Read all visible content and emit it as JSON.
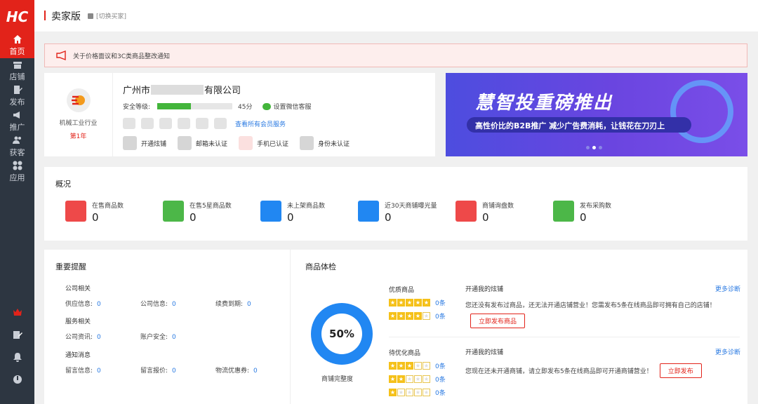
{
  "logo": {
    "text": "HC"
  },
  "sidebar": {
    "items": [
      {
        "label": "首页",
        "icon": "home-icon"
      },
      {
        "label": "店铺",
        "icon": "shop-icon"
      },
      {
        "label": "发布",
        "icon": "publish-icon"
      },
      {
        "label": "推广",
        "icon": "megaphone-icon"
      },
      {
        "label": "获客",
        "icon": "users-icon"
      },
      {
        "label": "应用",
        "icon": "apps-icon"
      }
    ],
    "bottom_icons": [
      "crown-icon",
      "edit-icon",
      "bell-icon",
      "power-icon"
    ]
  },
  "header": {
    "title": "卖家版",
    "switch_label": "[切换买家]"
  },
  "notice": {
    "text": "关于价格面议和3C类商品整改通知"
  },
  "company": {
    "industry": "机械工业行业",
    "years": "第1年",
    "name_prefix": "广州市",
    "name_suffix": "有限公司",
    "security_label": "安全等级:",
    "security_score": "45分",
    "security_fraction": 0.45,
    "wechat_label": "设置微信客服",
    "member_link": "查看所有会员服务",
    "certs": [
      {
        "label": "开通炫铺",
        "icon": "shop-cert-icon"
      },
      {
        "label": "邮箱未认证",
        "icon": "email-icon"
      },
      {
        "label": "手机已认证",
        "icon": "phone-icon"
      },
      {
        "label": "身份未认证",
        "icon": "id-icon"
      }
    ]
  },
  "banner": {
    "headline": "慧智投重磅推出",
    "sub": "高性价比的B2B推广 减少广告费消耗，让钱花在刀刃上"
  },
  "overview": {
    "title": "概况",
    "items": [
      {
        "label": "在售商品数",
        "value": "0",
        "color": "#ee4949"
      },
      {
        "label": "在售5星商品数",
        "value": "0",
        "color": "#4cb748"
      },
      {
        "label": "未上架商品数",
        "value": "0",
        "color": "#2187f2"
      },
      {
        "label": "近30天商铺曝光量",
        "value": "0",
        "color": "#2187f2"
      },
      {
        "label": "商铺询盘数",
        "value": "0",
        "color": "#ee4949"
      },
      {
        "label": "发布采购数",
        "value": "0",
        "color": "#4cb748"
      }
    ]
  },
  "reminders": {
    "title": "重要提醒",
    "groups": [
      {
        "heading": "公司相关",
        "items": [
          {
            "label": "供应信息:",
            "value": "0"
          },
          {
            "label": "公司信息:",
            "value": "0"
          },
          {
            "label": "续费到期:",
            "value": "0"
          }
        ]
      },
      {
        "heading": "服务相关",
        "items": [
          {
            "label": "公司资讯:",
            "value": "0"
          },
          {
            "label": "账户安全:",
            "value": "0"
          }
        ]
      },
      {
        "heading": "通知消息",
        "items": [
          {
            "label": "留言信息:",
            "value": "0"
          },
          {
            "label": "留言报价:",
            "value": "0"
          },
          {
            "label": "物流优惠券:",
            "value": "0"
          }
        ]
      }
    ]
  },
  "health": {
    "title": "商品体检",
    "percent": "50%",
    "percent_value": 50,
    "donut_label": "商铺完整度",
    "quality": {
      "title": "优质商品",
      "rows": [
        {
          "stars": 5,
          "count": "0条"
        },
        {
          "stars": 4,
          "count": "0条"
        }
      ],
      "diag_title": "开通我的炫铺",
      "more": "更多诊断",
      "desc": "您还没有发布过商品，还无法开通店铺营业！您需发布5条在线商品即可拥有自己的店铺！",
      "button": "立即发布商品"
    },
    "optimize": {
      "title": "待优化商品",
      "rows": [
        {
          "stars": 3,
          "count": "0条"
        },
        {
          "stars": 2,
          "count": "0条"
        },
        {
          "stars": 1,
          "count": "0条"
        }
      ],
      "diag_title": "开通我的炫铺",
      "more": "更多诊断",
      "desc": "您现在还未开通商铺，请立即发布5条在线商品即可开通商铺营业！",
      "button": "立即发布"
    }
  }
}
